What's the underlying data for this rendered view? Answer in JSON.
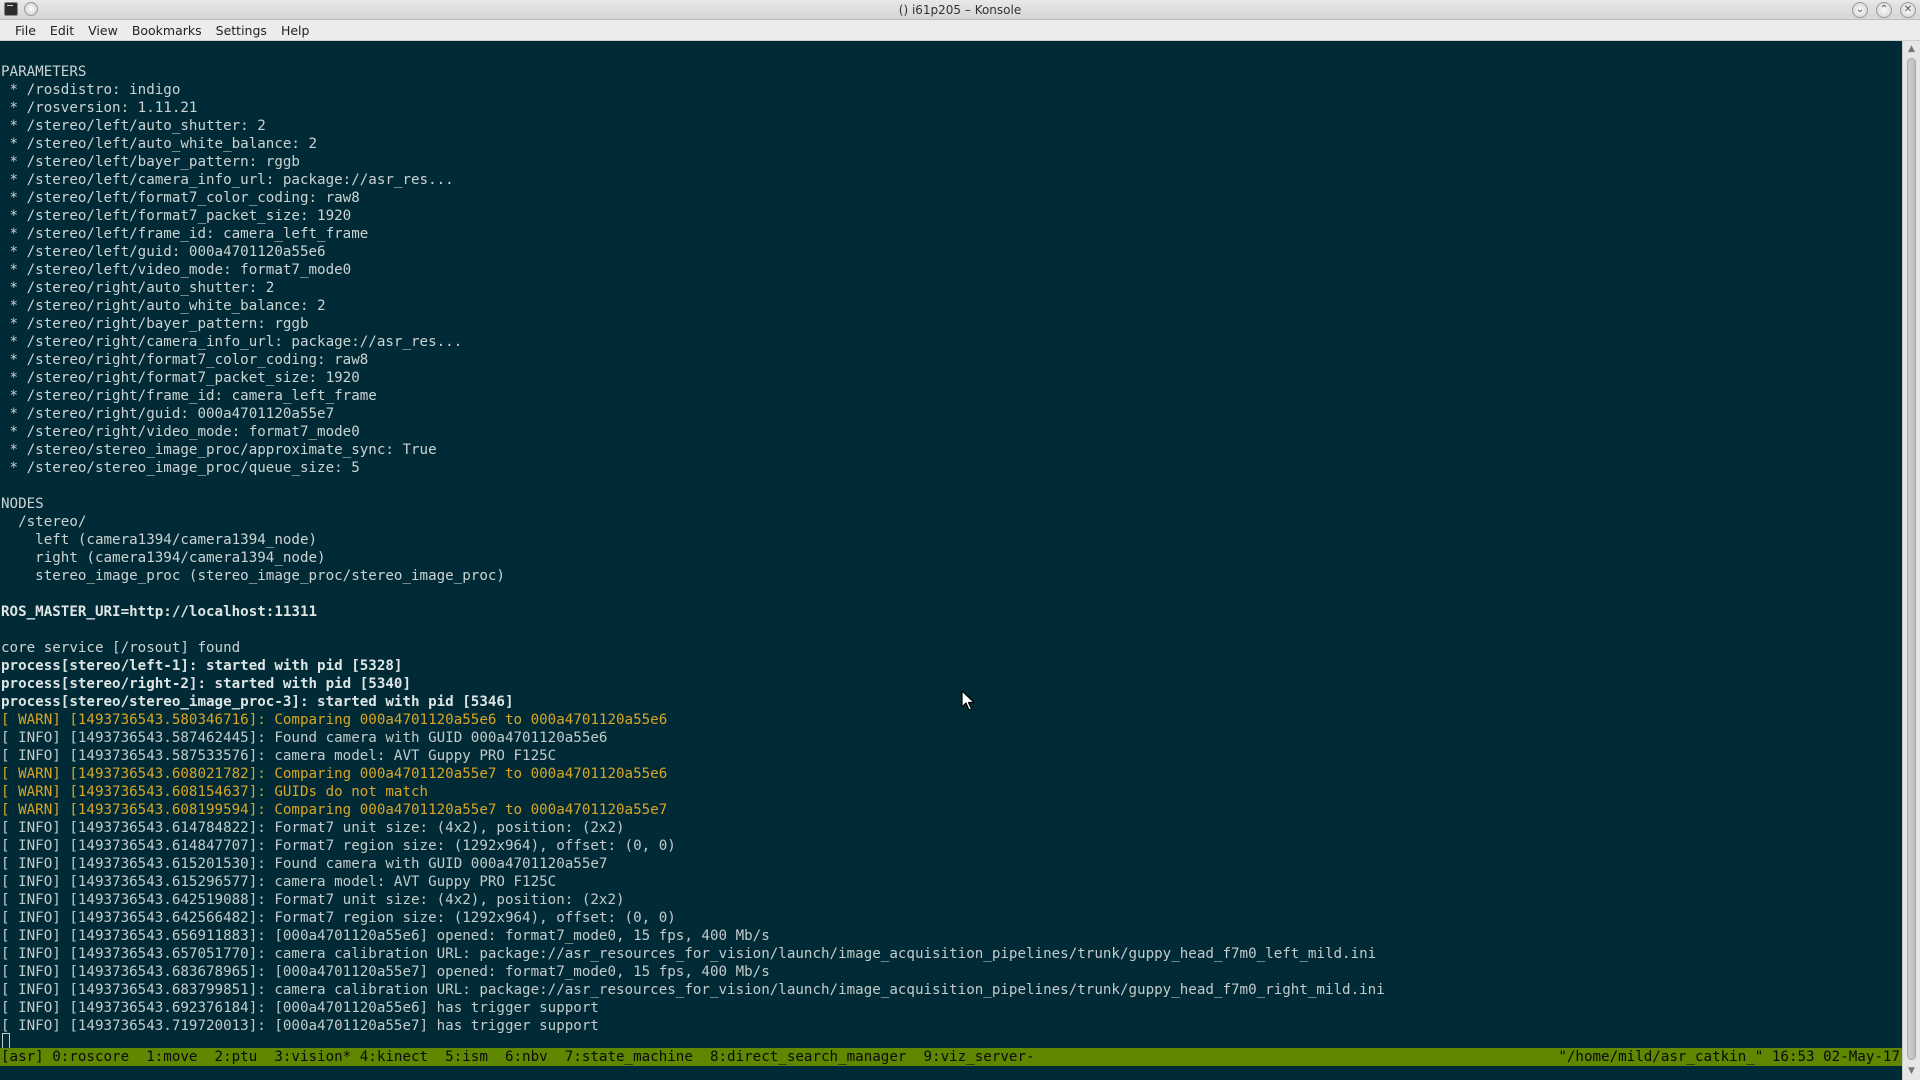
{
  "window": {
    "title": "() i61p205 – Konsole"
  },
  "menu": [
    "File",
    "Edit",
    "View",
    "Bookmarks",
    "Settings",
    "Help"
  ],
  "terminal": {
    "lines": [
      {
        "text": "PARAMETERS",
        "style": "normal"
      },
      {
        "text": " * /rosdistro: indigo",
        "style": "normal"
      },
      {
        "text": " * /rosversion: 1.11.21",
        "style": "normal"
      },
      {
        "text": " * /stereo/left/auto_shutter: 2",
        "style": "normal"
      },
      {
        "text": " * /stereo/left/auto_white_balance: 2",
        "style": "normal"
      },
      {
        "text": " * /stereo/left/bayer_pattern: rggb",
        "style": "normal"
      },
      {
        "text": " * /stereo/left/camera_info_url: package://asr_res...",
        "style": "normal"
      },
      {
        "text": " * /stereo/left/format7_color_coding: raw8",
        "style": "normal"
      },
      {
        "text": " * /stereo/left/format7_packet_size: 1920",
        "style": "normal"
      },
      {
        "text": " * /stereo/left/frame_id: camera_left_frame",
        "style": "normal"
      },
      {
        "text": " * /stereo/left/guid: 000a4701120a55e6",
        "style": "normal"
      },
      {
        "text": " * /stereo/left/video_mode: format7_mode0",
        "style": "normal"
      },
      {
        "text": " * /stereo/right/auto_shutter: 2",
        "style": "normal"
      },
      {
        "text": " * /stereo/right/auto_white_balance: 2",
        "style": "normal"
      },
      {
        "text": " * /stereo/right/bayer_pattern: rggb",
        "style": "normal"
      },
      {
        "text": " * /stereo/right/camera_info_url: package://asr_res...",
        "style": "normal"
      },
      {
        "text": " * /stereo/right/format7_color_coding: raw8",
        "style": "normal"
      },
      {
        "text": " * /stereo/right/format7_packet_size: 1920",
        "style": "normal"
      },
      {
        "text": " * /stereo/right/frame_id: camera_left_frame",
        "style": "normal"
      },
      {
        "text": " * /stereo/right/guid: 000a4701120a55e7",
        "style": "normal"
      },
      {
        "text": " * /stereo/right/video_mode: format7_mode0",
        "style": "normal"
      },
      {
        "text": " * /stereo/stereo_image_proc/approximate_sync: True",
        "style": "normal"
      },
      {
        "text": " * /stereo/stereo_image_proc/queue_size: 5",
        "style": "normal"
      },
      {
        "text": "",
        "style": "normal"
      },
      {
        "text": "NODES",
        "style": "normal"
      },
      {
        "text": "  /stereo/",
        "style": "normal"
      },
      {
        "text": "    left (camera1394/camera1394_node)",
        "style": "normal"
      },
      {
        "text": "    right (camera1394/camera1394_node)",
        "style": "normal"
      },
      {
        "text": "    stereo_image_proc (stereo_image_proc/stereo_image_proc)",
        "style": "normal"
      },
      {
        "text": "",
        "style": "normal"
      },
      {
        "text": "ROS_MASTER_URI=http://localhost:11311",
        "style": "bold"
      },
      {
        "text": "",
        "style": "normal"
      },
      {
        "text": "core service [/rosout] found",
        "style": "normal"
      },
      {
        "text": "process[stereo/left-1]: started with pid [5328]",
        "style": "bold"
      },
      {
        "text": "process[stereo/right-2]: started with pid [5340]",
        "style": "bold"
      },
      {
        "text": "process[stereo/stereo_image_proc-3]: started with pid [5346]",
        "style": "bold"
      },
      {
        "text": "[ WARN] [1493736543.580346716]: Comparing 000a4701120a55e6 to 000a4701120a55e6",
        "style": "warn"
      },
      {
        "text": "[ INFO] [1493736543.587462445]: Found camera with GUID 000a4701120a55e6",
        "style": "info"
      },
      {
        "text": "[ INFO] [1493736543.587533576]: camera model: AVT Guppy PRO F125C",
        "style": "info"
      },
      {
        "text": "[ WARN] [1493736543.608021782]: Comparing 000a4701120a55e7 to 000a4701120a55e6",
        "style": "warn"
      },
      {
        "text": "[ WARN] [1493736543.608154637]: GUIDs do not match",
        "style": "warn"
      },
      {
        "text": "[ WARN] [1493736543.608199594]: Comparing 000a4701120a55e7 to 000a4701120a55e7",
        "style": "warn"
      },
      {
        "text": "[ INFO] [1493736543.614784822]: Format7 unit size: (4x2), position: (2x2)",
        "style": "info"
      },
      {
        "text": "[ INFO] [1493736543.614847707]: Format7 region size: (1292x964), offset: (0, 0)",
        "style": "info"
      },
      {
        "text": "[ INFO] [1493736543.615201530]: Found camera with GUID 000a4701120a55e7",
        "style": "info"
      },
      {
        "text": "[ INFO] [1493736543.615296577]: camera model: AVT Guppy PRO F125C",
        "style": "info"
      },
      {
        "text": "[ INFO] [1493736543.642519088]: Format7 unit size: (4x2), position: (2x2)",
        "style": "info"
      },
      {
        "text": "[ INFO] [1493736543.642566482]: Format7 region size: (1292x964), offset: (0, 0)",
        "style": "info"
      },
      {
        "text": "[ INFO] [1493736543.656911883]: [000a4701120a55e6] opened: format7_mode0, 15 fps, 400 Mb/s",
        "style": "info"
      },
      {
        "text": "[ INFO] [1493736543.657051770]: camera calibration URL: package://asr_resources_for_vision/launch/image_acquisition_pipelines/trunk/guppy_head_f7m0_left_mild.ini",
        "style": "info"
      },
      {
        "text": "[ INFO] [1493736543.683678965]: [000a4701120a55e7] opened: format7_mode0, 15 fps, 400 Mb/s",
        "style": "info"
      },
      {
        "text": "[ INFO] [1493736543.683799851]: camera calibration URL: package://asr_resources_for_vision/launch/image_acquisition_pipelines/trunk/guppy_head_f7m0_right_mild.ini",
        "style": "info"
      },
      {
        "text": "[ INFO] [1493736543.692376184]: [000a4701120a55e6] has trigger support",
        "style": "info"
      },
      {
        "text": "[ INFO] [1493736543.719720013]: [000a4701120a55e7] has trigger support",
        "style": "info"
      }
    ]
  },
  "statusbar": {
    "left": "[asr] 0:roscore  1:move  2:ptu  3:vision* 4:kinect  5:ism  6:nbv  7:state_machine  8:direct_search_manager  9:viz_server-",
    "right": "\"/home/mild/asr_catkin_\" 16:53 02-May-17"
  },
  "colors": {
    "terminal_bg": "#002b36",
    "warn": "#d8a526",
    "status_bg": "#5f8700"
  },
  "icons": {
    "app": "konsole-icon",
    "minimize": "minimize-icon",
    "maximize": "maximize-icon",
    "close": "close-icon"
  }
}
